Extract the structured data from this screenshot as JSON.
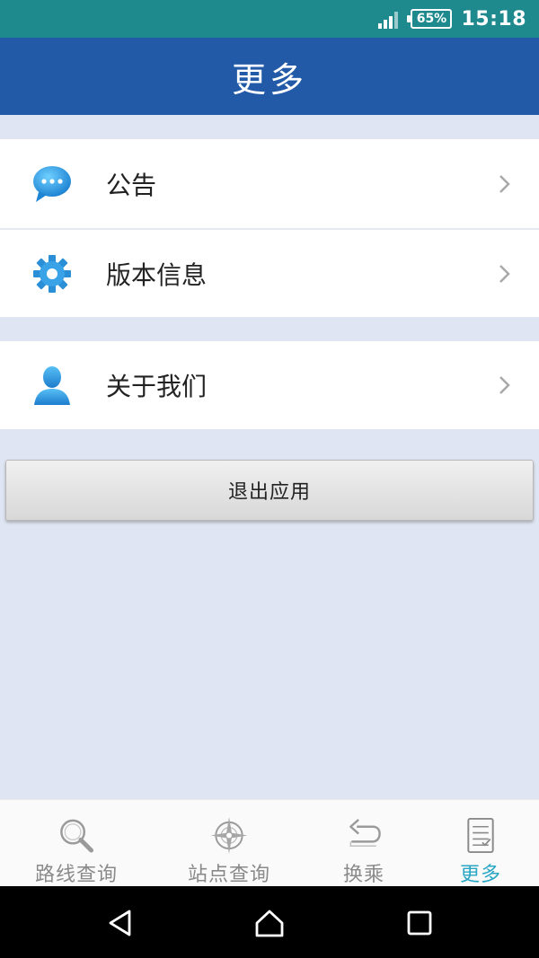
{
  "status_bar": {
    "battery": "65%",
    "time": "15:18"
  },
  "header": {
    "title": "更多"
  },
  "menu": {
    "group1": [
      {
        "label": "公告",
        "icon": "chat-bubble-icon"
      },
      {
        "label": "版本信息",
        "icon": "gear-icon"
      }
    ],
    "group2": [
      {
        "label": "关于我们",
        "icon": "user-icon"
      }
    ]
  },
  "exit_button": {
    "label": "退出应用"
  },
  "tabs": [
    {
      "label": "路线查询",
      "icon": "search-icon",
      "active": false
    },
    {
      "label": "站点查询",
      "icon": "compass-icon",
      "active": false
    },
    {
      "label": "换乘",
      "icon": "transfer-icon",
      "active": false
    },
    {
      "label": "更多",
      "icon": "list-icon",
      "active": true
    }
  ],
  "colors": {
    "status_bar": "#1f8a8e",
    "header": "#225aa8",
    "background": "#dfe5f2",
    "active_tab": "#2aa6c4"
  }
}
